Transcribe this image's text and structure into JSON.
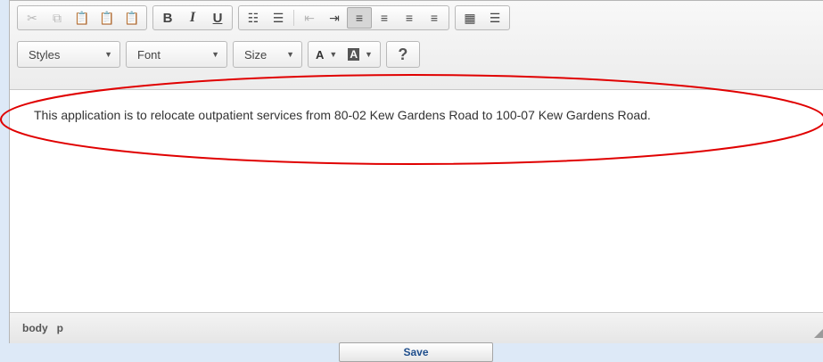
{
  "toolbar": {
    "row1": {
      "clipboard": [
        {
          "name": "cut-icon",
          "glyph": "✂",
          "disabled": true
        },
        {
          "name": "copy-icon",
          "glyph": "⧉",
          "disabled": true
        },
        {
          "name": "paste-icon",
          "glyph": "📋",
          "disabled": false
        },
        {
          "name": "paste-text-icon",
          "glyph": "📋",
          "disabled": false
        },
        {
          "name": "paste-word-icon",
          "glyph": "📋",
          "disabled": false
        }
      ],
      "format": [
        {
          "name": "bold-button",
          "label": "B"
        },
        {
          "name": "italic-button",
          "label": "I"
        },
        {
          "name": "underline-button",
          "label": "U"
        }
      ],
      "lists": [
        {
          "name": "numbered-list-icon",
          "glyph": "☷"
        },
        {
          "name": "bulleted-list-icon",
          "glyph": "☰"
        },
        {
          "name": "decrease-indent-icon",
          "glyph": "⇤",
          "disabled": true
        },
        {
          "name": "increase-indent-icon",
          "glyph": "⇥"
        }
      ],
      "align": [
        {
          "name": "align-left-icon",
          "glyph": "≡",
          "active": true
        },
        {
          "name": "align-center-icon",
          "glyph": "≡"
        },
        {
          "name": "align-right-icon",
          "glyph": "≡"
        },
        {
          "name": "justify-icon",
          "glyph": "≡"
        }
      ],
      "insert": [
        {
          "name": "table-icon",
          "glyph": "▦"
        },
        {
          "name": "horizontal-rule-icon",
          "glyph": "☰"
        }
      ]
    },
    "row2": {
      "styles_label": "Styles",
      "font_label": "Font",
      "size_label": "Size",
      "text_color_label": "A",
      "bg_color_label": "A",
      "help_label": "?"
    }
  },
  "editor": {
    "paragraph": "This application is to relocate outpatient services from 80-02 Kew Gardens Road to 100-07 Kew Gardens Road."
  },
  "statusbar": {
    "path": [
      "body",
      "p"
    ]
  },
  "save_label": "Save",
  "colors": {
    "annotation": "#e00000",
    "accent": "#1f4e8c"
  }
}
